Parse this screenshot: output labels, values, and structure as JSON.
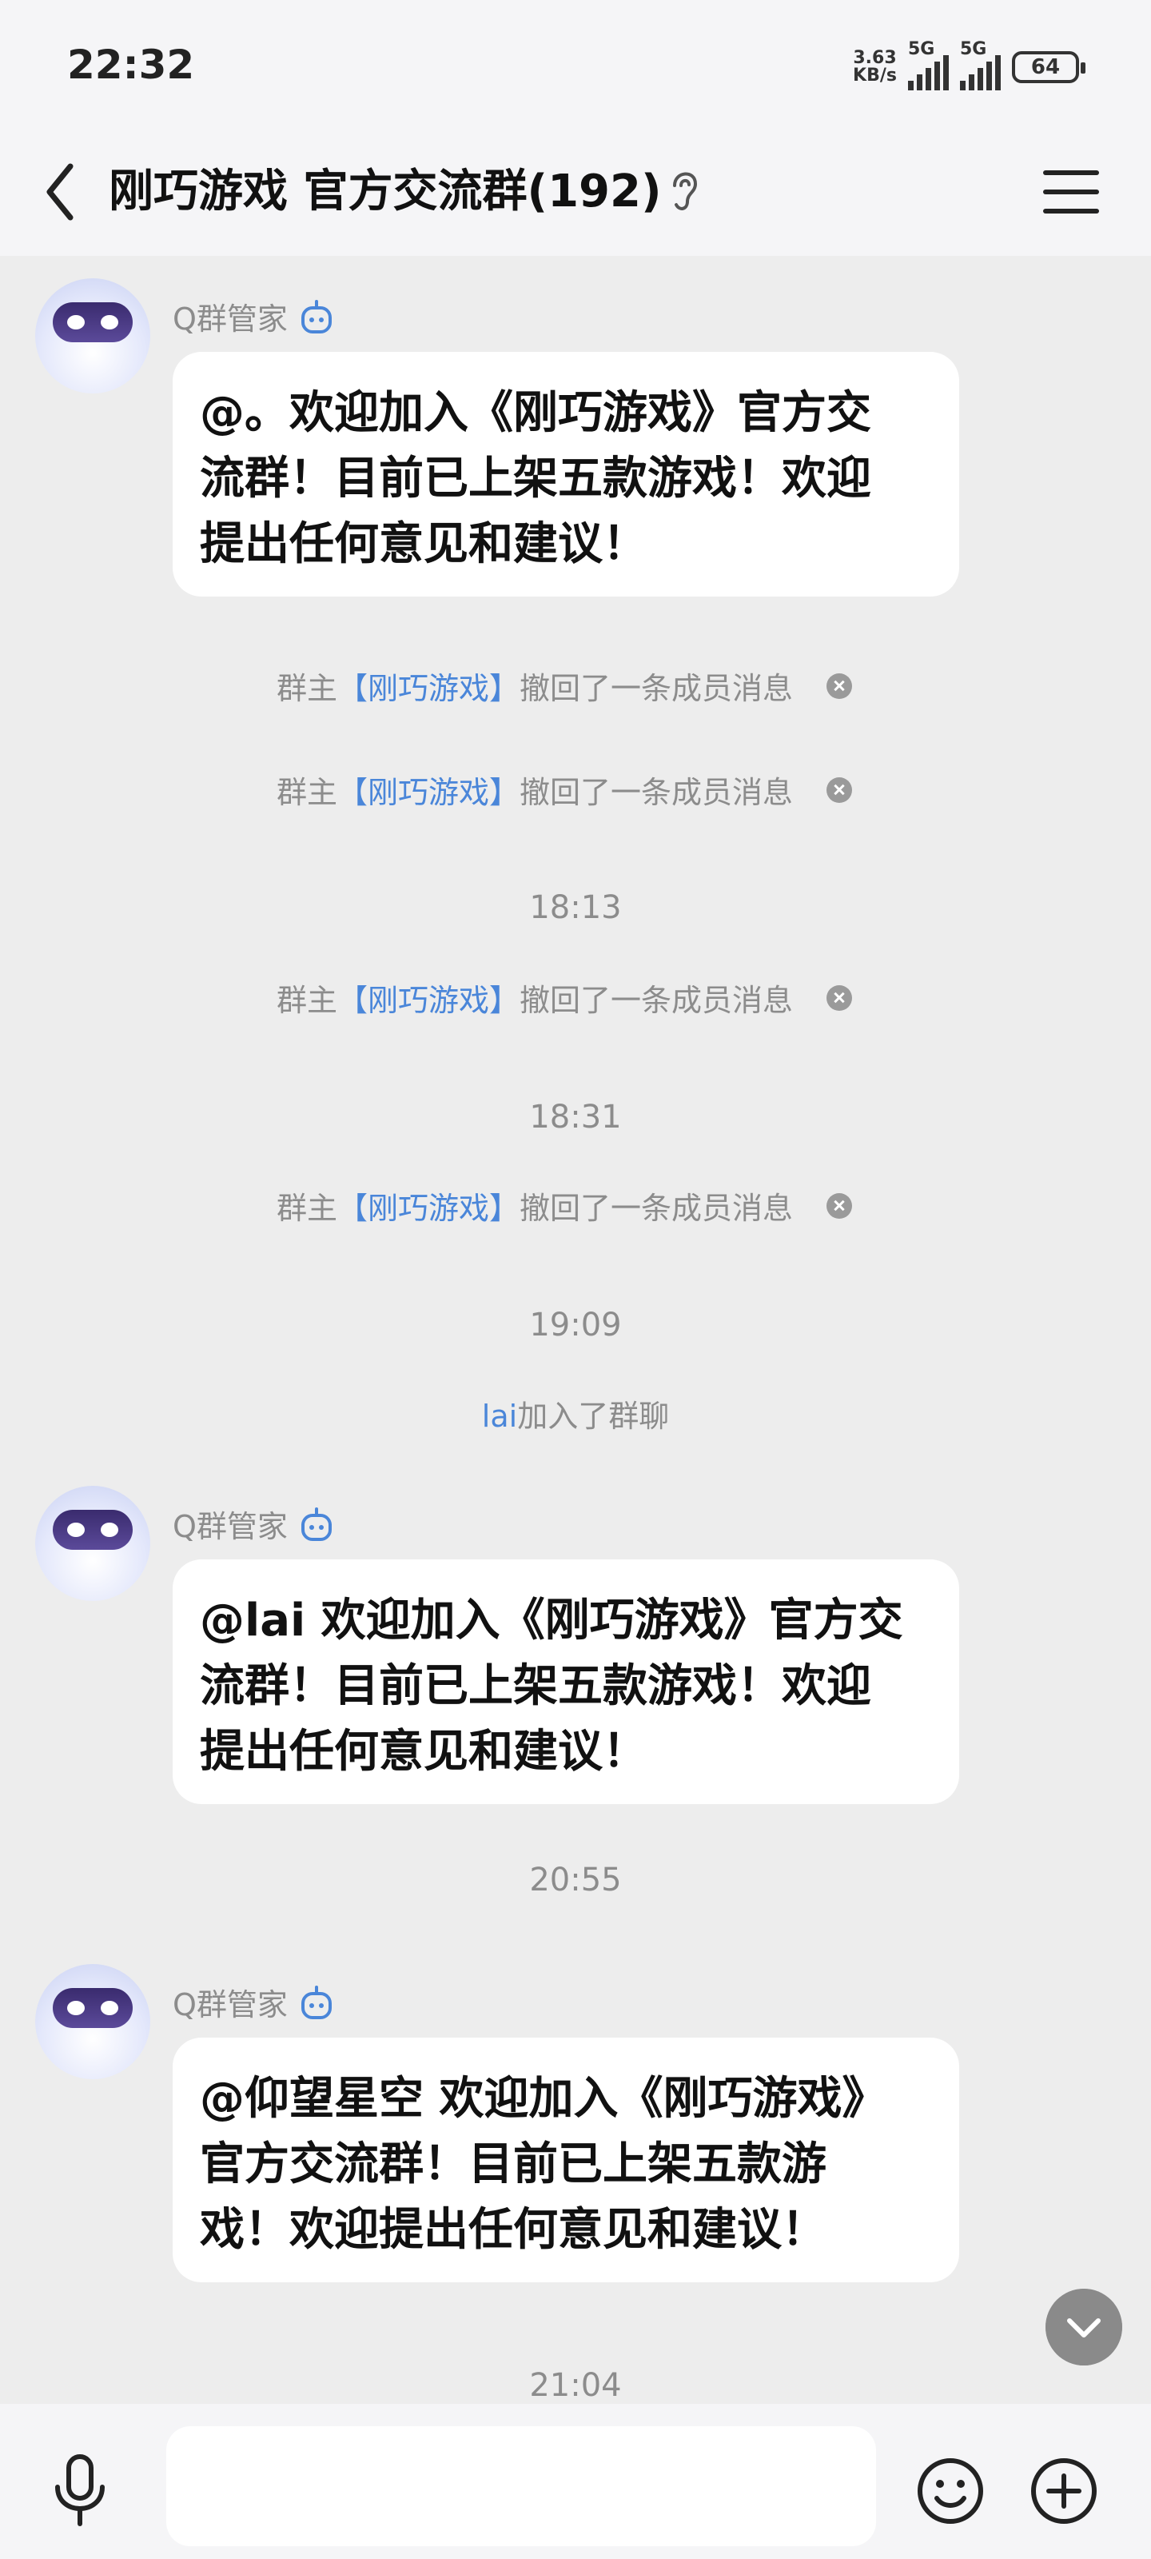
{
  "status_bar": {
    "time": "22:32",
    "net_speed_value": "3.63",
    "net_speed_unit": "KB/s",
    "sim1_label": "5G",
    "sim2_label": "5G",
    "battery": "64"
  },
  "header": {
    "title": "刚巧游戏 官方交流群(192)",
    "icons": [
      "back-icon",
      "ear-icon",
      "menu-icon"
    ]
  },
  "chat": {
    "messages": [
      {
        "sender": "Q群管家",
        "text": "@。欢迎加入《刚巧游戏》官方交流群！目前已上架五款游戏！欢迎提出任何意见和建议！",
        "lines": [
          "@。欢迎加入《刚巧游戏》官方交",
          "流群！目前已上架五款游戏！欢迎",
          "提出任何意见和建议！"
        ]
      },
      {
        "sender": "Q群管家",
        "text": "@lai 欢迎加入《刚巧游戏》官方交流群！目前已上架五款游戏！欢迎提出任何意见和建议！",
        "lines": [
          "@lai 欢迎加入《刚巧游戏》官方交",
          "流群！目前已上架五款游戏！欢迎",
          "提出任何意见和建议！"
        ]
      },
      {
        "sender": "Q群管家",
        "text": "@仰望星空 欢迎加入《刚巧游戏》官方交流群！目前已上架五款游戏！欢迎提出任何意见和建议！",
        "lines": [
          "@仰望星空 欢迎加入《刚巧游戏》",
          "官方交流群！目前已上架五款游",
          "戏！欢迎提出任何意见和建议！"
        ]
      }
    ],
    "recall_notice": {
      "prefix": "群主",
      "name": "【刚巧游戏】",
      "suffix": "撤回了一条成员消息"
    },
    "timestamps": [
      "18:13",
      "18:31",
      "19:09",
      "20:55",
      "21:04"
    ],
    "join_notice": {
      "name": "lai",
      "suffix": "加入了群聊"
    }
  },
  "input_bar": {
    "value": "",
    "icons": [
      "mic-icon",
      "emoji-icon",
      "plus-icon"
    ]
  }
}
